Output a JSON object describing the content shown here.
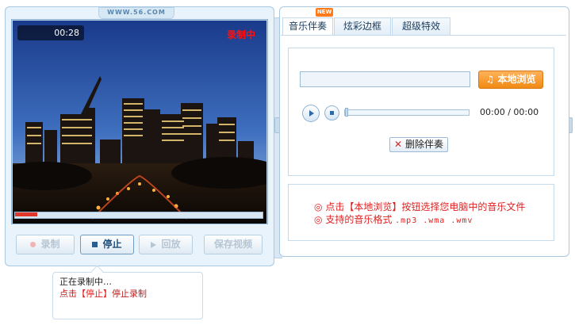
{
  "recorder": {
    "site": "WWW.56.COM",
    "timer": "00:28",
    "status_overlay": "录制中",
    "progress": 0.09,
    "buttons": {
      "record": "录制",
      "stop": "停止",
      "playback": "回放",
      "save": "保存视频"
    },
    "tip": {
      "line1": "正在录制中…",
      "line2_prefix": "点击",
      "line2_highlight": "【停止】",
      "line2_suffix": "停止录制"
    }
  },
  "tabs": [
    {
      "label": "音乐伴奏",
      "badge": "NEW",
      "active": true
    },
    {
      "label": "炫彩边框",
      "active": false
    },
    {
      "label": "超级特效",
      "active": false
    }
  ],
  "music": {
    "file_value": "",
    "browse_label": "本地浏览",
    "time_current": "00:00",
    "time_total": "00:00",
    "delete_label": "删除伴奏"
  },
  "notes": [
    {
      "bullet": "◎",
      "text": "点击【本地浏览】按钮选择您电脑中的音乐文件"
    },
    {
      "bullet": "◎",
      "text_prefix": "支持的音乐格式 ",
      "formats": ".mp3 .wma .wmv"
    }
  ],
  "colors": {
    "accent_red": "#e02020",
    "orange_button": "#f08a14",
    "panel_blue": "#e9f3fb"
  }
}
